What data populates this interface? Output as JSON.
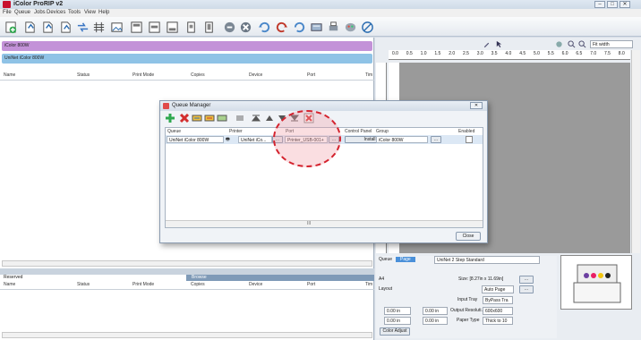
{
  "window": {
    "title": "iColor ProRIP v2"
  },
  "menu": [
    "File",
    "Queue",
    "Jobs",
    "Devices",
    "Tools",
    "View",
    "Help"
  ],
  "toolbar_icons": [
    "add-job-icon",
    "add-doc-icon",
    "add-doc2-icon",
    "add-doc3-icon",
    "move-icon",
    "grid-icon",
    "image-icon",
    "layout1-icon",
    "layout2-icon",
    "layout3-icon",
    "page-icon",
    "page2-icon",
    "cut-icon",
    "cancel-icon",
    "refresh-left-icon",
    "refresh-right-icon",
    "refresh2-icon",
    "queue-icon",
    "printer-icon",
    "palette-icon",
    "stop-icon"
  ],
  "printer_bars": [
    {
      "label": "iColor 800W",
      "color": "#c392d8"
    },
    {
      "label": "UniNet iColor 800W",
      "color": "#8fc3e6"
    }
  ],
  "columns": [
    "Name",
    "Status",
    "Print Mode",
    "Copies",
    "Device",
    "Port",
    "Tim"
  ],
  "lower_tabs": {
    "reserved": "Reserved",
    "browse": "Browse"
  },
  "lower_columns": [
    "Name",
    "Status",
    "Print Mode",
    "Copies",
    "Device",
    "Port",
    "Tim"
  ],
  "right_toolbar": {
    "zoom": "Fit width"
  },
  "ruler_labels": [
    "0.0",
    "0.5",
    "1.0",
    "1.5",
    "2.0",
    "2.5",
    "3.0",
    "3.5",
    "4.0",
    "4.5",
    "5.0",
    "5.5",
    "6.0",
    "6.5",
    "7.0",
    "7.5",
    "8.0"
  ],
  "queue_manager": {
    "title": "Queue Manager",
    "columns": [
      "Queue",
      "Printer",
      "Port",
      "Control Panel",
      "Group",
      "Enabled"
    ],
    "row": {
      "queue": "UniNet iColor 800W",
      "printer": "UniNet iCo...",
      "port": "Printer_USB-001+",
      "control_panel": "Install",
      "group": "iColor 800W",
      "enabled": ""
    },
    "close_label": "Close",
    "scroll_mid": "III"
  },
  "page_settings": {
    "tab_queue": "Queue",
    "tab_page": "Page",
    "preset": "UniNet 2 Step Standard",
    "paper": "A4",
    "size": "Size: [8.27in x 11.69in]",
    "layout_label": "Layout",
    "layout_value": "Auto Page",
    "input_tray_label": "Input Tray",
    "input_tray_value": "ByPass Tra",
    "output_res_label": "Output Resoluti...",
    "output_res_value": "600x600",
    "paper_type_label": "Paper Type",
    "paper_type_value": "Thick to 10",
    "offset1": "0.00 in",
    "offset2": "0.00 in",
    "offset3": "0.00 in",
    "offset4": "0.00 in",
    "color_adjust": "Color Adjust"
  }
}
